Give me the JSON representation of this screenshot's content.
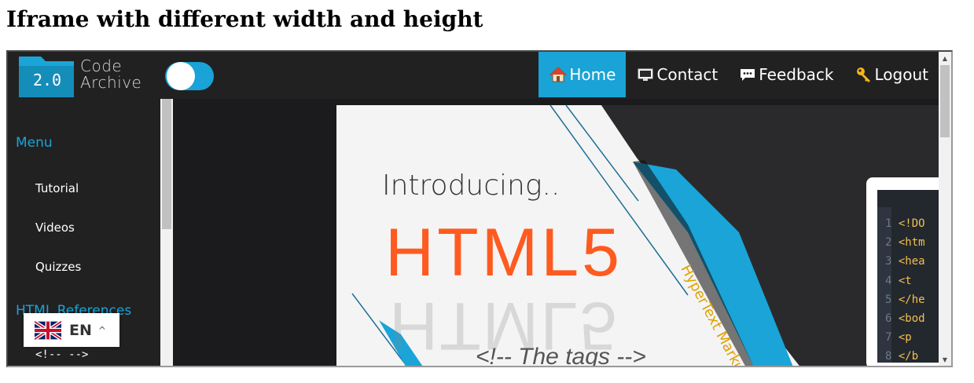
{
  "page": {
    "heading": "Iframe with different width and height"
  },
  "site": {
    "logo_version": "2.0",
    "logo_line1": "Code",
    "logo_line2": "Archive",
    "nav": [
      {
        "label": "Home",
        "icon": "home-icon",
        "active": true
      },
      {
        "label": "Contact",
        "icon": "monitor-icon",
        "active": false
      },
      {
        "label": "Feedback",
        "icon": "speech-bubble-icon",
        "active": false
      },
      {
        "label": "Logout",
        "icon": "key-icon",
        "active": false
      }
    ],
    "sidebar": {
      "menu_heading": "Menu",
      "links": [
        "Tutorial",
        "Videos",
        "Quizzes"
      ],
      "references_heading": "HTML References",
      "code_item": "<!-- -->"
    }
  },
  "banner": {
    "intro": "Introducing..",
    "title": "HTML5",
    "tagline": "HyperText Markup La",
    "tags_text": "<!-- The tags -->",
    "code_lines": [
      {
        "num": "1",
        "text": "<!DO"
      },
      {
        "num": "2",
        "text": "<htm"
      },
      {
        "num": "3",
        "text": "<hea"
      },
      {
        "num": "4",
        "text": "  <t"
      },
      {
        "num": "5",
        "text": "</he"
      },
      {
        "num": "6",
        "text": "<bod"
      },
      {
        "num": "7",
        "text": "  <p"
      },
      {
        "num": "8",
        "text": "</b"
      }
    ]
  },
  "language": {
    "code": "EN",
    "flag": "uk-flag-icon"
  },
  "colors": {
    "accent": "#19a3d6",
    "nav_bg": "#212121",
    "html5_orange": "#ff5a1f"
  }
}
